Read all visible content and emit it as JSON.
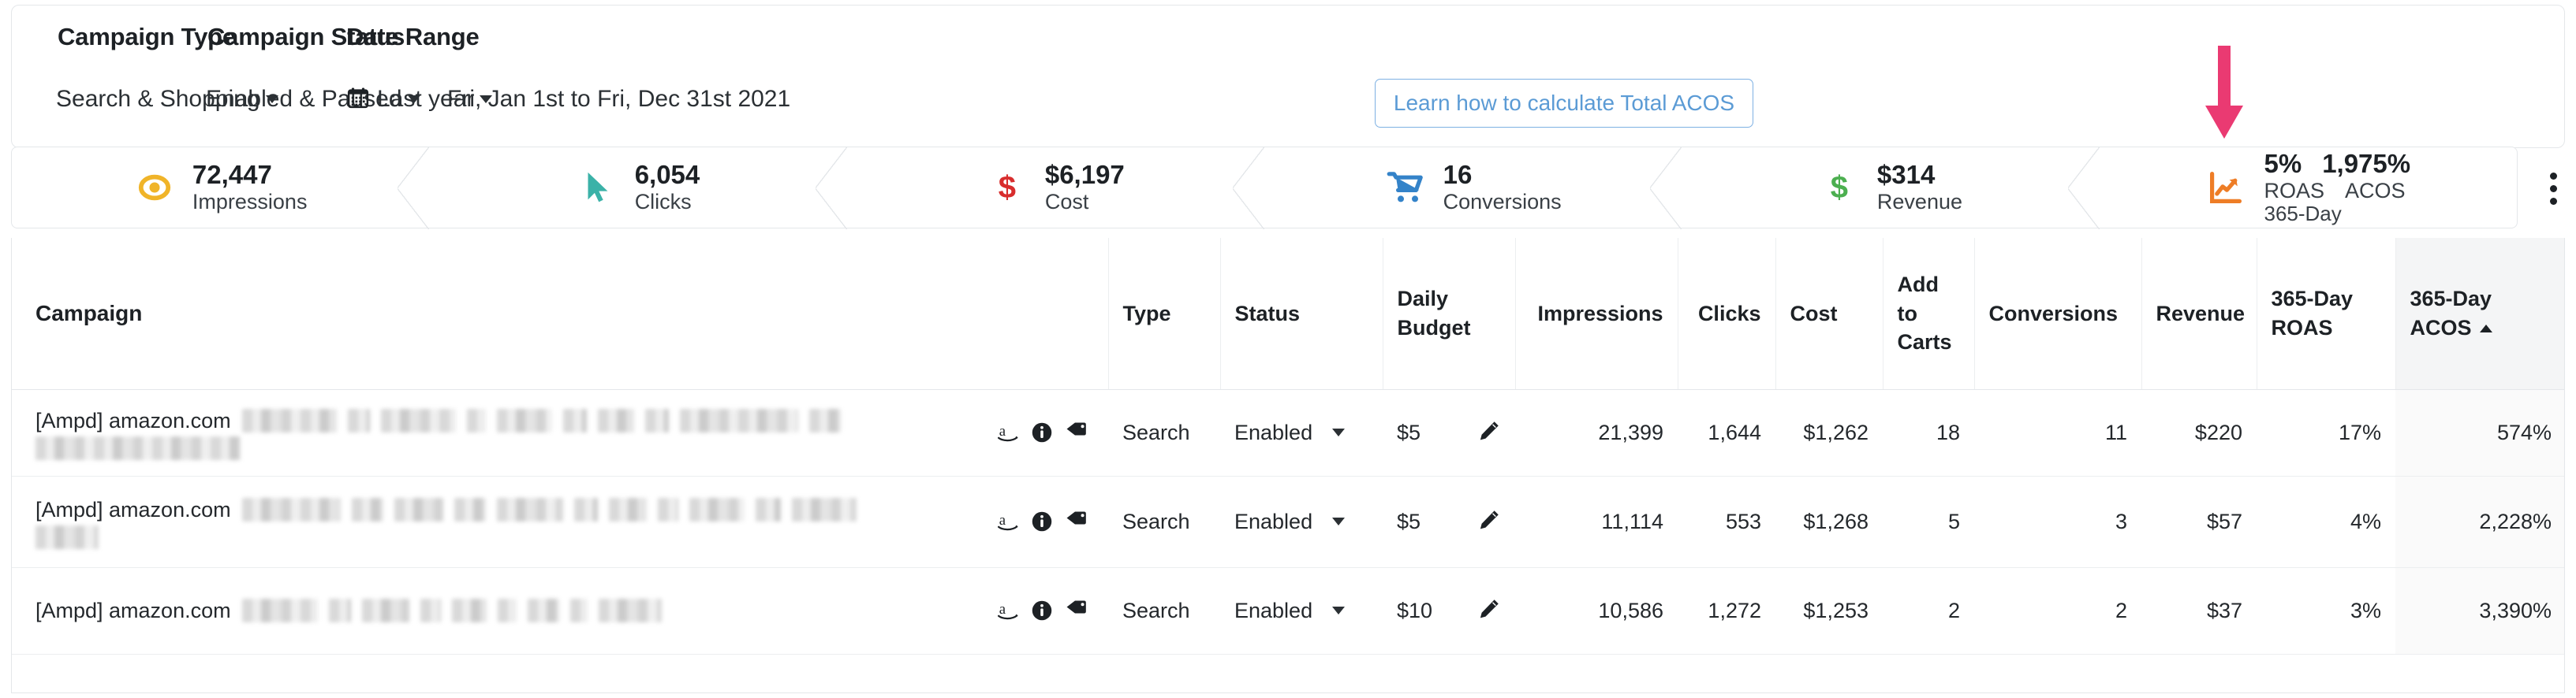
{
  "filters": {
    "campaign_type": {
      "label": "Campaign Type",
      "value": "Search & Shopping"
    },
    "campaign_status": {
      "label": "Campaign Status",
      "value": "Enabled & Paused"
    },
    "date_range": {
      "label": "Date Range",
      "value": "Last year",
      "range_text": "Fri, Jan 1st to Fri, Dec 31st 2021"
    },
    "learn_button": "Learn how to calculate Total ACOS"
  },
  "kpis": [
    {
      "value": "72,447",
      "label": "Impressions",
      "icon": "eye-icon",
      "color": "#f0b429"
    },
    {
      "value": "6,054",
      "label": "Clicks",
      "icon": "cursor-icon",
      "color": "#3bb2a8"
    },
    {
      "value": "$6,197",
      "label": "Cost",
      "icon": "dollar-icon",
      "color": "#d82d2d"
    },
    {
      "value": "16",
      "label": "Conversions",
      "icon": "cart-icon",
      "color": "#3483c9"
    },
    {
      "value": "$314",
      "label": "Revenue",
      "icon": "dollar-icon",
      "color": "#4caf50"
    }
  ],
  "kpi_dual": {
    "icon": "trending-chart-icon",
    "icon_color": "#ee7d26",
    "roas_value": "5%",
    "roas_label": "ROAS",
    "acos_value": "1,975%",
    "acos_label": "ACOS",
    "sub_label": "365-Day"
  },
  "annotation": {
    "arrow": "down-arrow-annotation",
    "color": "#ea3a72"
  },
  "table": {
    "columns": [
      {
        "key": "campaign",
        "label": "Campaign",
        "align": "left"
      },
      {
        "key": "type",
        "label": "Type",
        "align": "left"
      },
      {
        "key": "status",
        "label": "Status",
        "align": "left"
      },
      {
        "key": "daily_budget",
        "label": "Daily\nBudget",
        "line1": "Daily",
        "line2": "Budget",
        "align": "left"
      },
      {
        "key": "impressions",
        "label": "Impressions",
        "align": "right"
      },
      {
        "key": "clicks",
        "label": "Clicks",
        "align": "right"
      },
      {
        "key": "cost",
        "label": "Cost",
        "align": "right"
      },
      {
        "key": "add_to_carts",
        "line1": "Add",
        "line2": "to",
        "line3": "Carts",
        "label": "Add to Carts",
        "align": "left"
      },
      {
        "key": "conversions",
        "label": "Conversions",
        "align": "right"
      },
      {
        "key": "revenue",
        "label": "Revenue",
        "align": "right"
      },
      {
        "key": "roas",
        "line1": "365-Day",
        "line2": "ROAS",
        "label": "365-Day ROAS",
        "align": "right"
      },
      {
        "key": "acos",
        "line1": "365-Day",
        "line2": "ACOS",
        "label": "365-Day ACOS",
        "align": "right",
        "sorted": "ascending"
      }
    ],
    "rows": [
      {
        "campaign_prefix": "[Ampd] amazon.com",
        "campaign_redacted_widths": [
          120,
          28,
          95,
          24,
          70,
          30,
          46,
          30,
          150,
          40,
          260
        ],
        "icons": [
          "amazon-icon",
          "info-icon",
          "tag-icon"
        ],
        "type": "Search",
        "status": "Enabled",
        "daily_budget": "$5",
        "impressions": "21,399",
        "clicks": "1,644",
        "cost": "$1,262",
        "add_to_carts": "18",
        "conversions": "11",
        "revenue": "$220",
        "roas": "17%",
        "acos": "574%"
      },
      {
        "campaign_prefix": "[Ampd] amazon.com",
        "campaign_redacted_widths": [
          125,
          40,
          62,
          40,
          84,
          30,
          48,
          26,
          70,
          32,
          82
        ],
        "campaign_redacted_widths_line2": [
          80
        ],
        "icons": [
          "amazon-icon",
          "info-icon",
          "tag-icon"
        ],
        "type": "Search",
        "status": "Enabled",
        "daily_budget": "$5",
        "impressions": "11,114",
        "clicks": "553",
        "cost": "$1,268",
        "add_to_carts": "5",
        "conversions": "3",
        "revenue": "$57",
        "roas": "4%",
        "acos": "2,228%"
      },
      {
        "campaign_prefix": "[Ampd] amazon.com",
        "campaign_redacted_widths": [
          96,
          28,
          60,
          26,
          44,
          24,
          40,
          22,
          80
        ],
        "icons": [
          "amazon-icon",
          "info-icon",
          "tag-icon"
        ],
        "type": "Search",
        "status": "Enabled",
        "daily_budget": "$10",
        "impressions": "10,586",
        "clicks": "1,272",
        "cost": "$1,253",
        "add_to_carts": "2",
        "conversions": "2",
        "revenue": "$37",
        "roas": "3%",
        "acos": "3,390%"
      }
    ]
  }
}
